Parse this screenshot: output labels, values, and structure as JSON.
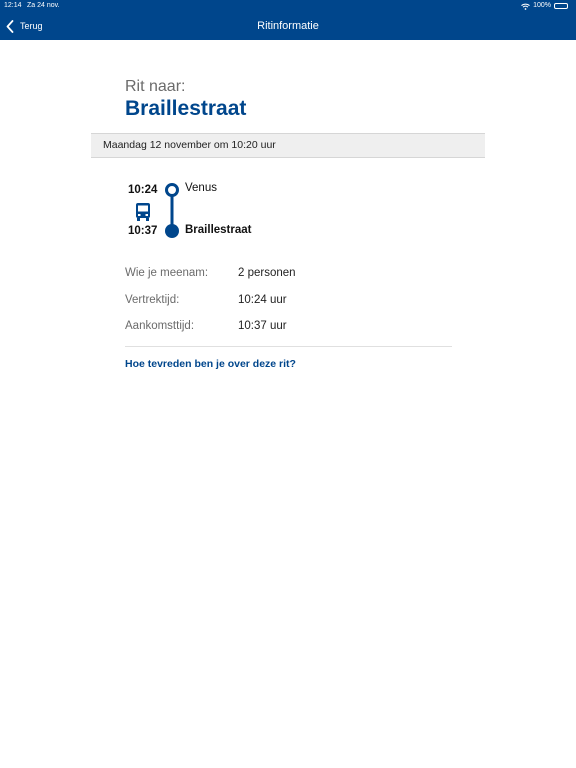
{
  "status_bar": {
    "time": "12:14",
    "date": "Za 24 nov.",
    "battery": "100%",
    "battery_level": 1.0
  },
  "nav": {
    "back_label": "Terug",
    "title": "Ritinformatie"
  },
  "trip": {
    "label": "Rit naar:",
    "destination": "Braillestraat",
    "date_line": "Maandag 12 november om 10:20 uur"
  },
  "route": {
    "departure_time": "10:24",
    "departure_stop": "Venus",
    "arrival_time": "10:37",
    "arrival_stop": "Braillestraat",
    "transport_icon": "bus-icon"
  },
  "details": [
    {
      "label": "Wie je meenam:",
      "value": "2 personen"
    },
    {
      "label": "Vertrektijd:",
      "value": "10:24 uur"
    },
    {
      "label": "Aankomsttijd:",
      "value": "10:37 uur"
    }
  ],
  "feedback_link": "Hoe tevreden ben je over deze rit?",
  "colors": {
    "brand": "#00468c",
    "muted_text": "#6b6b6b",
    "band_bg": "#efefef"
  }
}
